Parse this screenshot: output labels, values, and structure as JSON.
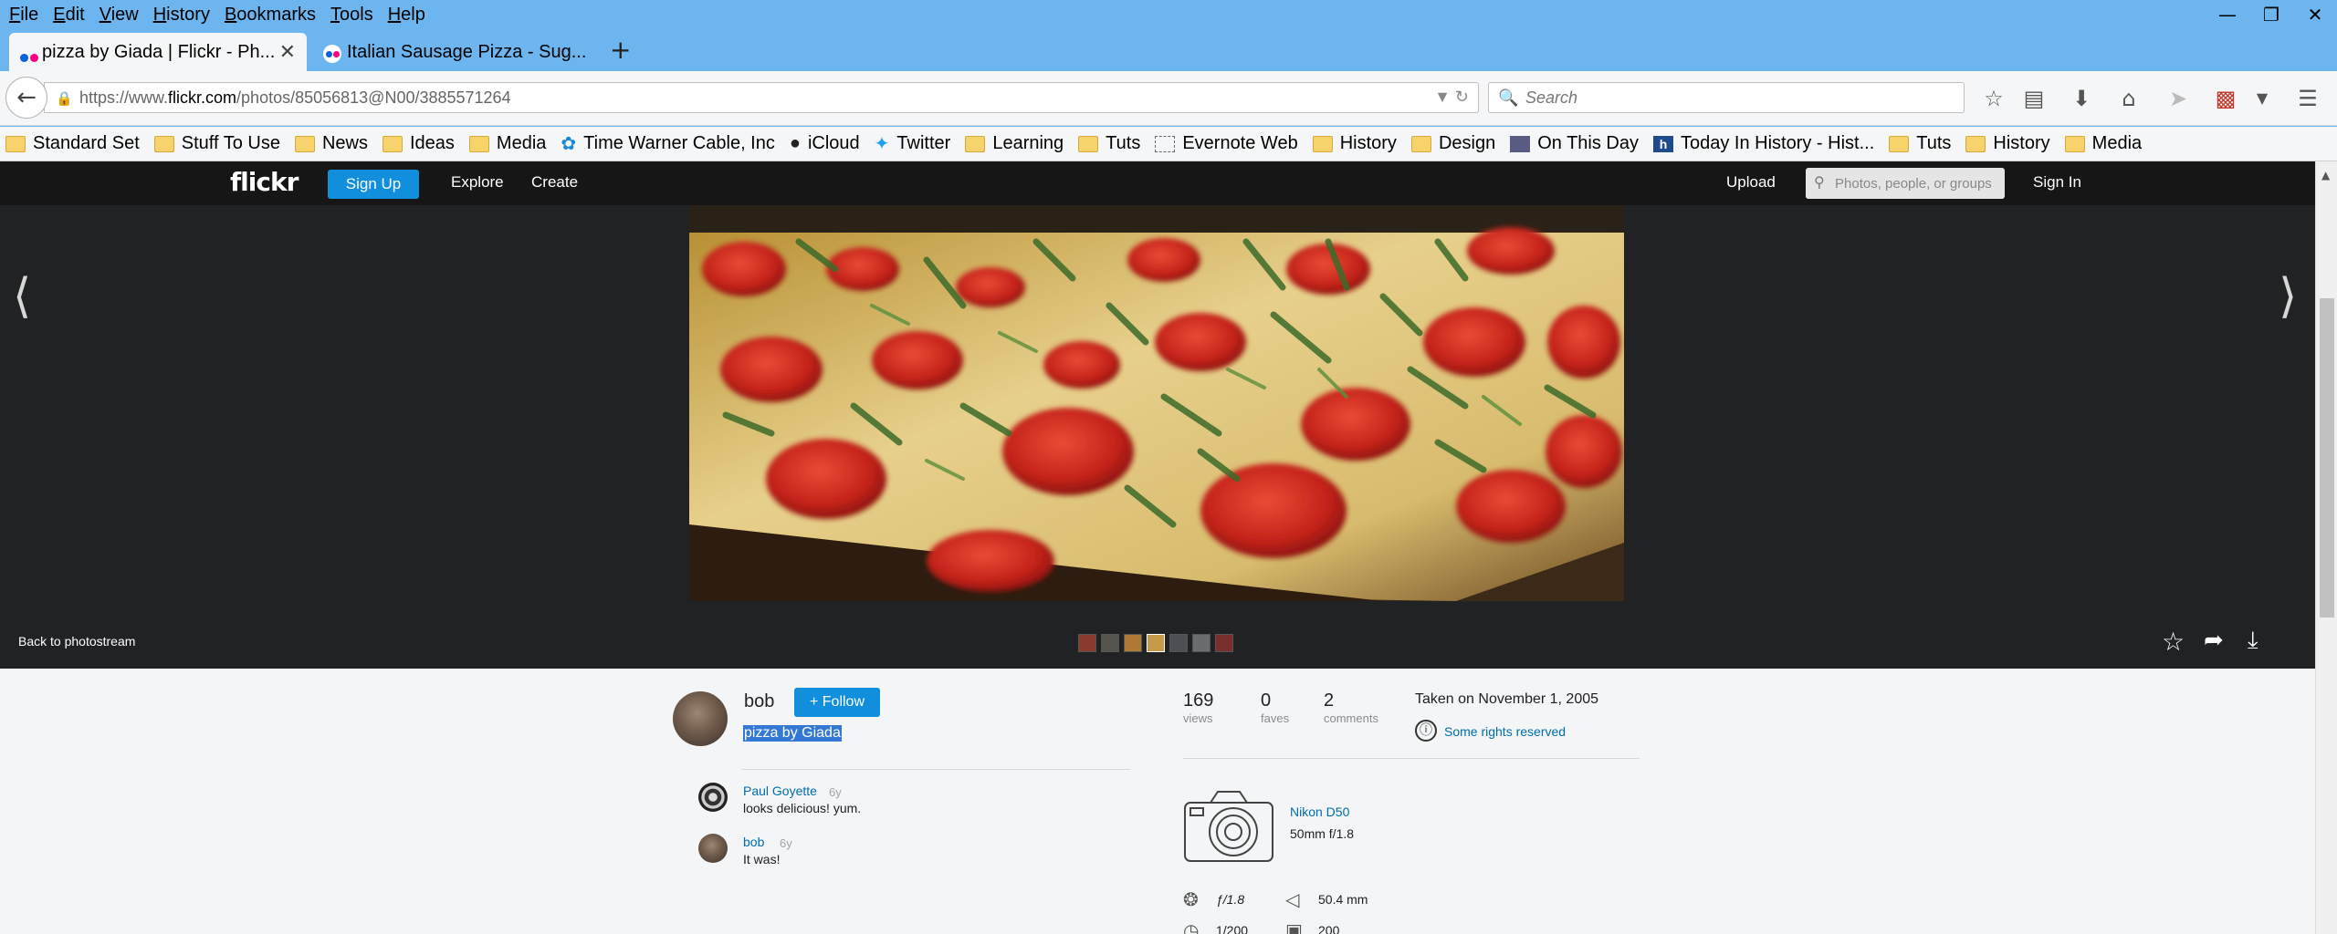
{
  "menubar": {
    "items": [
      {
        "label": "File",
        "u": "F",
        "rest": "ile"
      },
      {
        "label": "Edit",
        "u": "E",
        "rest": "dit"
      },
      {
        "label": "View",
        "u": "V",
        "rest": "iew"
      },
      {
        "label": "History",
        "u": "H",
        "rest": "istory"
      },
      {
        "label": "Bookmarks",
        "u": "B",
        "rest": "ookmarks"
      },
      {
        "label": "Tools",
        "u": "T",
        "rest": "ools"
      },
      {
        "label": "Help",
        "u": "H",
        "rest": "elp"
      }
    ]
  },
  "tabs": [
    {
      "label": "pizza by Giada | Flickr - Ph...",
      "active": true
    },
    {
      "label": "Italian Sausage Pizza - Sug...",
      "active": false
    }
  ],
  "navbar": {
    "url_prefix": "https://www.",
    "url_domain": "flickr.com",
    "url_path": "/photos/85056813@N00/3885571264",
    "search_placeholder": "Search"
  },
  "bookmarks": [
    {
      "label": "Standard Set",
      "icon": "folder-icon"
    },
    {
      "label": "Stuff To Use",
      "icon": "folder-icon"
    },
    {
      "label": "News",
      "icon": "folder-icon"
    },
    {
      "label": "Ideas",
      "icon": "folder-icon"
    },
    {
      "label": "Media",
      "icon": "folder-icon"
    },
    {
      "label": "Time Warner Cable, Inc",
      "icon": "twc-icon"
    },
    {
      "label": "iCloud",
      "icon": "apple-icon"
    },
    {
      "label": "Twitter",
      "icon": "twitter-icon"
    },
    {
      "label": "Learning",
      "icon": "folder-icon"
    },
    {
      "label": "Tuts",
      "icon": "folder-icon"
    },
    {
      "label": "Evernote Web",
      "icon": "page-icon"
    },
    {
      "label": "History",
      "icon": "folder-icon"
    },
    {
      "label": "Design",
      "icon": "folder-icon"
    },
    {
      "label": "On This Day",
      "icon": "otd-icon"
    },
    {
      "label": "Today In History - Hist...",
      "icon": "hn-icon"
    },
    {
      "label": "Tuts",
      "icon": "folder-icon"
    },
    {
      "label": "History",
      "icon": "folder-icon"
    },
    {
      "label": "Media",
      "icon": "folder-icon"
    }
  ],
  "flickr": {
    "logo": "flickr",
    "signup": "Sign Up",
    "explore": "Explore",
    "create": "Create",
    "upload": "Upload",
    "search_placeholder": "Photos, people, or groups",
    "signin": "Sign In",
    "back_to_photostream": "Back to photostream"
  },
  "owner": {
    "name": "bob",
    "follow_label": "+ Follow",
    "photo_title": "pizza by Giada"
  },
  "comments": [
    {
      "author": "Paul Goyette",
      "age": "6y",
      "text": "looks delicious! yum."
    },
    {
      "author": "bob",
      "age": "6y",
      "text": "It was!"
    }
  ],
  "stats": [
    {
      "value": "169",
      "label": "views"
    },
    {
      "value": "0",
      "label": "faves"
    },
    {
      "value": "2",
      "label": "comments"
    }
  ],
  "taken": "Taken on November 1, 2005",
  "rights": "Some rights reserved",
  "camera": {
    "name": "Nikon D50",
    "lens": "50mm f/1.8",
    "aperture": "ƒ/1.8",
    "focal": "50.4 mm",
    "shutter": "1/200",
    "iso": "200"
  },
  "colors": {
    "browser_accent": "#6db5ee",
    "flickr_blue": "#128fdc",
    "link": "#006dac",
    "viewer_bg": "#212224"
  }
}
